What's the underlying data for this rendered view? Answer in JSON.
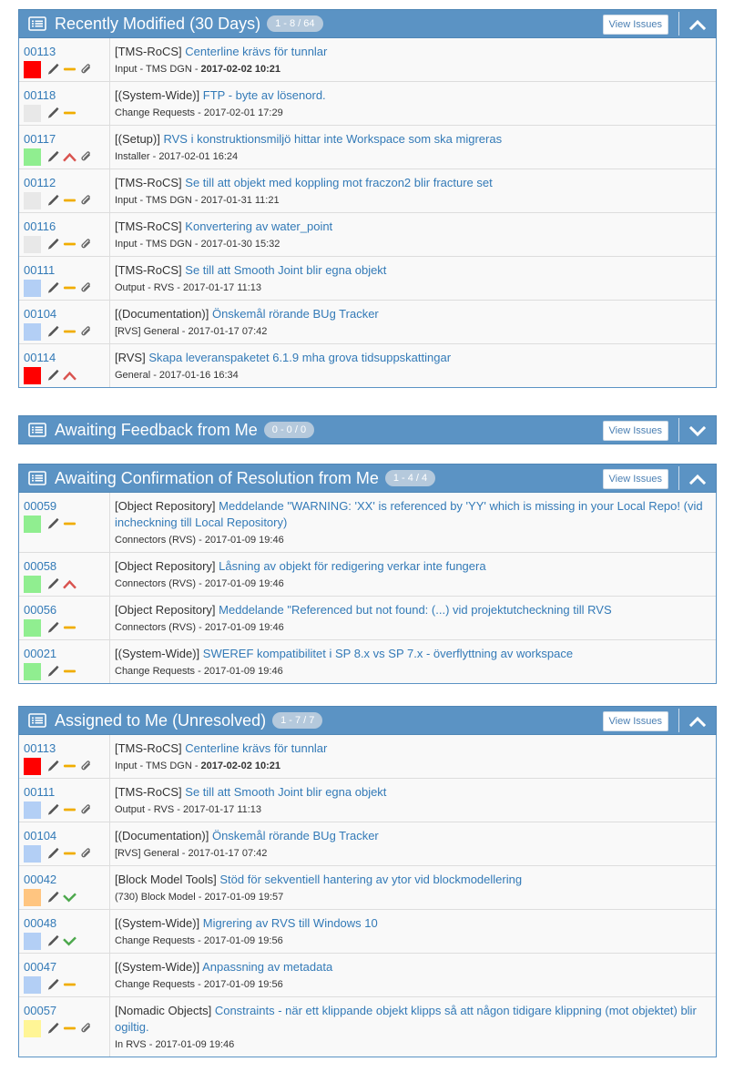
{
  "colors": {
    "header": "#5b93c4",
    "link": "#337ab7",
    "priority_red": "#ff0000",
    "priority_green": "#90ee90",
    "priority_grey": "#e8e8e8",
    "priority_blue": "#b3cff5",
    "priority_orange": "#ffc580",
    "priority_yellow": "#fff596"
  },
  "widgets": [
    {
      "title": "Recently Modified (30 Days)",
      "badge": "1 - 8 / 64",
      "view_label": "View Issues",
      "collapsed": false,
      "toggle_icon": "chevron-up-icon",
      "rows": [
        {
          "id": "00113",
          "prio": "#ff0000",
          "icons": [
            "pencil",
            "dash",
            "clip"
          ],
          "project": "[TMS-RoCS]",
          "title": "Centerline krävs för tunnlar",
          "category": "Input - TMS DGN",
          "date": "2017-02-02 10:21",
          "bold": true
        },
        {
          "id": "00118",
          "prio": "#e8e8e8",
          "icons": [
            "pencil",
            "dash"
          ],
          "project": "[(System-Wide)]",
          "title": "FTP - byte av lösenord.",
          "category": "Change Requests",
          "date": "2017-02-01 17:29",
          "bold": false
        },
        {
          "id": "00117",
          "prio": "#90ee90",
          "icons": [
            "pencil",
            "up",
            "clip"
          ],
          "project": "[(Setup)]",
          "title": "RVS i konstruktionsmiljö hittar inte Workspace som ska migreras",
          "category": "Installer",
          "date": "2017-02-01 16:24",
          "bold": false
        },
        {
          "id": "00112",
          "prio": "#e8e8e8",
          "icons": [
            "pencil",
            "dash",
            "clip"
          ],
          "project": "[TMS-RoCS]",
          "title": "Se till att objekt med koppling mot fraczon2 blir fracture set",
          "category": "Input - TMS DGN",
          "date": "2017-01-31 11:21",
          "bold": false
        },
        {
          "id": "00116",
          "prio": "#e8e8e8",
          "icons": [
            "pencil",
            "dash",
            "clip"
          ],
          "project": "[TMS-RoCS]",
          "title": "Konvertering av water_point",
          "category": "Input - TMS DGN",
          "date": "2017-01-30 15:32",
          "bold": false
        },
        {
          "id": "00111",
          "prio": "#b3cff5",
          "icons": [
            "pencil",
            "dash",
            "clip"
          ],
          "project": "[TMS-RoCS]",
          "title": "Se till att Smooth Joint blir egna objekt",
          "category": "Output - RVS",
          "date": "2017-01-17 11:13",
          "bold": false
        },
        {
          "id": "00104",
          "prio": "#b3cff5",
          "icons": [
            "pencil",
            "dash",
            "clip"
          ],
          "project": "[(Documentation)]",
          "title": "Önskemål rörande BUg Tracker",
          "category": "[RVS] General",
          "date": "2017-01-17 07:42",
          "bold": false
        },
        {
          "id": "00114",
          "prio": "#ff0000",
          "icons": [
            "pencil",
            "up"
          ],
          "project": "[RVS]",
          "title": "Skapa leveranspaketet 6.1.9 mha grova tidsuppskattingar",
          "category": "General",
          "date": "2017-01-16 16:34",
          "bold": false
        }
      ]
    },
    {
      "title": "Awaiting Feedback from Me",
      "badge": "0 - 0 / 0",
      "view_label": "View Issues",
      "collapsed": true,
      "toggle_icon": "chevron-down-icon",
      "rows": []
    },
    {
      "title": "Awaiting Confirmation of Resolution from Me",
      "badge": "1 - 4 / 4",
      "view_label": "View Issues",
      "collapsed": false,
      "toggle_icon": "chevron-up-icon",
      "rows": [
        {
          "id": "00059",
          "prio": "#90ee90",
          "icons": [
            "pencil",
            "dash"
          ],
          "project": "[Object Repository]",
          "title": "Meddelande \"WARNING: 'XX' is referenced by 'YY' which is missing in your Local Repo! (vid incheckning till Local Repository)",
          "category": "Connectors (RVS)",
          "date": "2017-01-09 19:46",
          "bold": false
        },
        {
          "id": "00058",
          "prio": "#90ee90",
          "icons": [
            "pencil",
            "up"
          ],
          "project": "[Object Repository]",
          "title": "Låsning av objekt för redigering verkar inte fungera",
          "category": "Connectors (RVS)",
          "date": "2017-01-09 19:46",
          "bold": false
        },
        {
          "id": "00056",
          "prio": "#90ee90",
          "icons": [
            "pencil",
            "dash"
          ],
          "project": "[Object Repository]",
          "title": "Meddelande \"Referenced but not found: (...) vid projektutcheckning till RVS",
          "category": "Connectors (RVS)",
          "date": "2017-01-09 19:46",
          "bold": false
        },
        {
          "id": "00021",
          "prio": "#90ee90",
          "icons": [
            "pencil",
            "dash"
          ],
          "project": "[(System-Wide)]",
          "title": "SWEREF kompatibilitet i SP 8.x vs SP 7.x - överflyttning av workspace",
          "category": "Change Requests",
          "date": "2017-01-09 19:46",
          "bold": false
        }
      ]
    },
    {
      "title": "Assigned to Me (Unresolved)",
      "badge": "1 - 7 / 7",
      "view_label": "View Issues",
      "collapsed": false,
      "toggle_icon": "chevron-up-icon",
      "rows": [
        {
          "id": "00113",
          "prio": "#ff0000",
          "icons": [
            "pencil",
            "dash",
            "clip"
          ],
          "project": "[TMS-RoCS]",
          "title": "Centerline krävs för tunnlar",
          "category": "Input - TMS DGN",
          "date": "2017-02-02 10:21",
          "bold": true
        },
        {
          "id": "00111",
          "prio": "#b3cff5",
          "icons": [
            "pencil",
            "dash",
            "clip"
          ],
          "project": "[TMS-RoCS]",
          "title": "Se till att Smooth Joint blir egna objekt",
          "category": "Output - RVS",
          "date": "2017-01-17 11:13",
          "bold": false
        },
        {
          "id": "00104",
          "prio": "#b3cff5",
          "icons": [
            "pencil",
            "dash",
            "clip"
          ],
          "project": "[(Documentation)]",
          "title": "Önskemål rörande BUg Tracker",
          "category": "[RVS] General",
          "date": "2017-01-17 07:42",
          "bold": false
        },
        {
          "id": "00042",
          "prio": "#ffc580",
          "icons": [
            "pencil",
            "check"
          ],
          "project": "[Block Model Tools]",
          "title": "Stöd för sekventiell hantering av ytor vid blockmodellering",
          "category": "(730) Block Model",
          "date": "2017-01-09 19:57",
          "bold": false
        },
        {
          "id": "00048",
          "prio": "#b3cff5",
          "icons": [
            "pencil",
            "check"
          ],
          "project": "[(System-Wide)]",
          "title": "Migrering av RVS till Windows 10",
          "category": "Change Requests",
          "date": "2017-01-09 19:56",
          "bold": false
        },
        {
          "id": "00047",
          "prio": "#b3cff5",
          "icons": [
            "pencil",
            "dash"
          ],
          "project": "[(System-Wide)]",
          "title": "Anpassning av metadata",
          "category": "Change Requests",
          "date": "2017-01-09 19:56",
          "bold": false
        },
        {
          "id": "00057",
          "prio": "#fff596",
          "icons": [
            "pencil",
            "dash",
            "clip"
          ],
          "project": "[Nomadic Objects]",
          "title": "Constraints - när ett klippande objekt klipps så att någon tidigare klippning (mot objektet) blir ogiltig.",
          "category": "In RVS",
          "date": "2017-01-09 19:46",
          "bold": false
        }
      ]
    }
  ]
}
